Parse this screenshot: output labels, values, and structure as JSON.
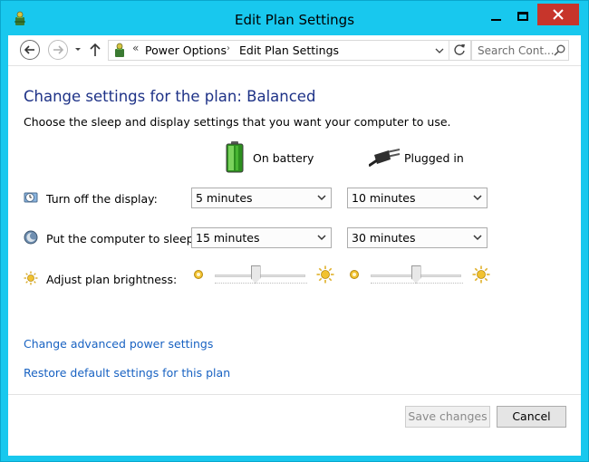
{
  "window": {
    "title": "Edit Plan Settings"
  },
  "navigation": {
    "back_icon": "back-arrow-icon",
    "forward_icon": "forward-arrow-icon",
    "up_icon": "up-arrow-icon",
    "breadcrumb_overflow": "«",
    "breadcrumbs": [
      "Power Options",
      "Edit Plan Settings"
    ],
    "breadcrumb_separator": "›",
    "search_placeholder": "Search Cont..."
  },
  "plan": {
    "heading": "Change settings for the plan: Balanced",
    "subtitle": "Choose the sleep and display settings that you want your computer to use.",
    "columns": {
      "on_battery": "On battery",
      "plugged_in": "Plugged in"
    },
    "display": {
      "label": "Turn off the display:",
      "on_battery": "5 minutes",
      "plugged_in": "10 minutes"
    },
    "sleep": {
      "label": "Put the computer to sleep:",
      "on_battery": "15 minutes",
      "plugged_in": "30 minutes"
    },
    "brightness": {
      "label": "Adjust plan brightness:",
      "on_battery_level": 0.45,
      "plugged_in_level": 0.5
    }
  },
  "links": {
    "advanced": "Change advanced power settings",
    "restore": "Restore default settings for this plan"
  },
  "footer": {
    "save": "Save changes",
    "cancel": "Cancel"
  },
  "colors": {
    "frame": "#18c8ee",
    "close": "#c7352b",
    "heading": "#1e3287",
    "link": "#1862c2"
  }
}
